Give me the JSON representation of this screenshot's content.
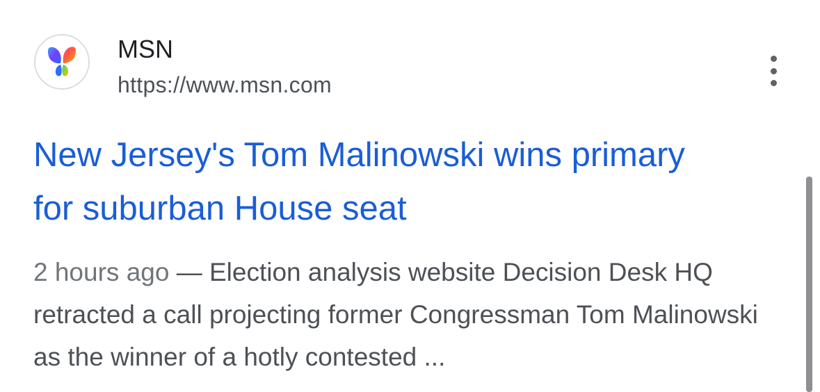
{
  "source": {
    "icon": "msn-butterfly-icon",
    "name": "MSN",
    "url": "https://www.msn.com"
  },
  "more_options": {
    "icon": "more-vert-icon"
  },
  "result": {
    "title": "New Jersey's Tom Malinowski wins primary for suburban House seat",
    "date": "2 hours ago",
    "separator": " — ",
    "snippet": "Election analysis website Decision Desk HQ retracted a call projecting former Congressman Tom Malinowski as the winner of a hotly contested ..."
  },
  "colors": {
    "link": "#1a5dd6",
    "text": "#202124",
    "secondary": "#4d5156",
    "scrollbar": "#8e8e93"
  }
}
